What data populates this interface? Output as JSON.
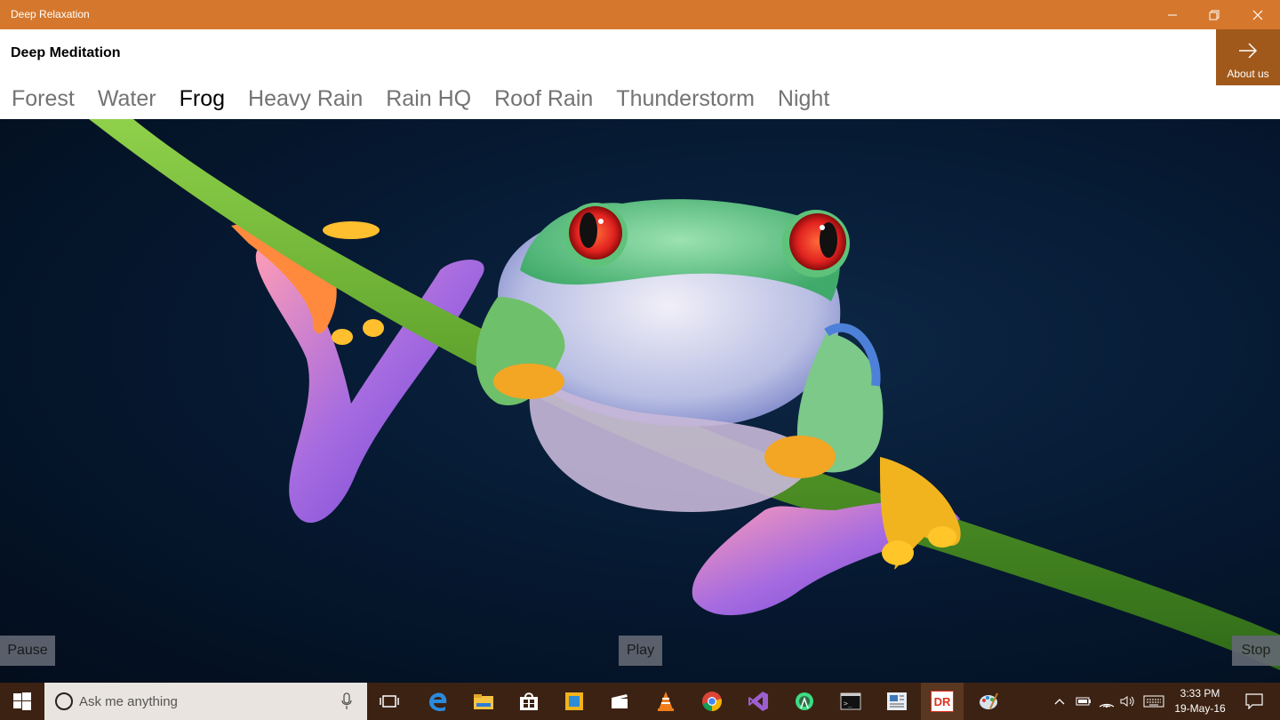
{
  "window": {
    "title": "Deep Relaxation"
  },
  "app": {
    "title": "Deep Meditation",
    "about_label": "About us"
  },
  "tabs": [
    {
      "label": "Forest"
    },
    {
      "label": "Water"
    },
    {
      "label": "Frog",
      "active": true
    },
    {
      "label": "Heavy Rain"
    },
    {
      "label": "Rain HQ"
    },
    {
      "label": "Roof Rain"
    },
    {
      "label": "Thunderstorm"
    },
    {
      "label": "Night"
    }
  ],
  "controls": {
    "pause": "Pause",
    "play": "Play",
    "stop": "Stop"
  },
  "taskbar": {
    "search_placeholder": "Ask me anything",
    "time": "3:33 PM",
    "date": "19-May-16",
    "apps": [
      "task-view-icon",
      "edge-icon",
      "file-explorer-icon",
      "store-icon",
      "outlook-icon",
      "video-editor-icon",
      "vlc-icon",
      "chrome-icon",
      "visual-studio-icon",
      "android-studio-icon",
      "command-prompt-icon",
      "news-icon",
      "deep-relaxation-icon",
      "paint-icon"
    ],
    "deep_relaxation_tile": "DR"
  },
  "colors": {
    "titlebar": "#d5782d",
    "about_tile": "#a0591b",
    "taskbar": "#3c2213"
  }
}
